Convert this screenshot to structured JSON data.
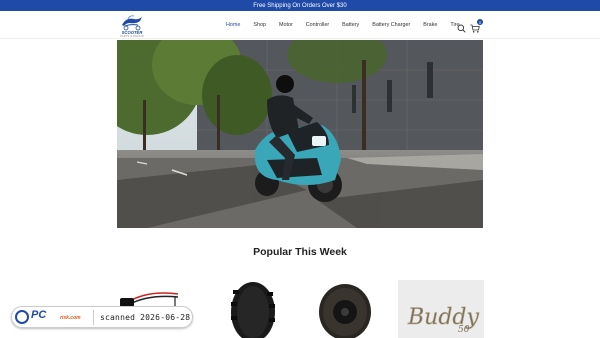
{
  "announcement": {
    "text": "Free Shipping On Orders Over $30"
  },
  "logo": {
    "name": "SCOOTER",
    "tagline": "PARTS & REPAIR"
  },
  "nav": {
    "items": [
      {
        "label": "Home",
        "active": true
      },
      {
        "label": "Shop",
        "active": false
      },
      {
        "label": "Motor",
        "active": false
      },
      {
        "label": "Controller",
        "active": false
      },
      {
        "label": "Battery",
        "active": false
      },
      {
        "label": "Battery Charger",
        "active": false
      },
      {
        "label": "Brake",
        "active": false
      },
      {
        "label": "Tire",
        "active": false
      }
    ]
  },
  "header_icons": {
    "search": "search-icon",
    "cart": "cart-icon",
    "cart_count": "0"
  },
  "hero": {
    "image": "rider on teal scooter on tree-lined street"
  },
  "section": {
    "title": "Popular This Week"
  },
  "products": [
    {
      "image": "battery connector cable"
    },
    {
      "image": "knobby tire"
    },
    {
      "image": "tire with black rim"
    },
    {
      "image": "Buddy 50 emblem"
    }
  ],
  "watermark": {
    "brand": "PC",
    "brand_suffix": "risk.com",
    "scan_text": "scanned 2026-06-28"
  },
  "colors": {
    "brand_blue": "#1f4aa8",
    "teal_scooter": "#3aa7b8"
  }
}
